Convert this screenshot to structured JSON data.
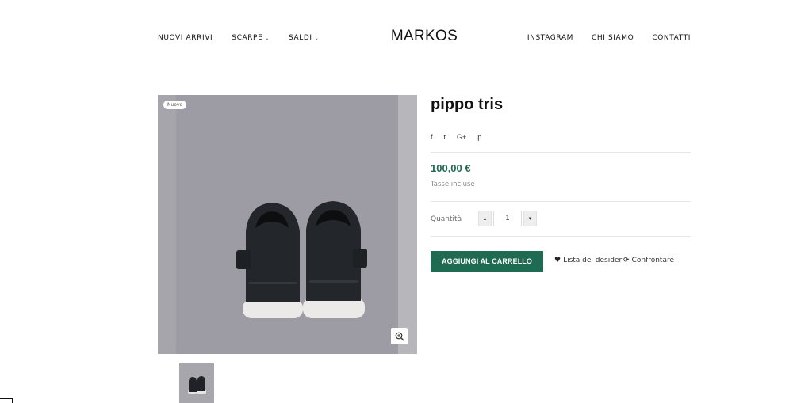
{
  "header": {
    "logo": "MARKOS",
    "nav_left": [
      {
        "label": "NUOVI ARRIVI",
        "has_dropdown": false
      },
      {
        "label": "SCARPE",
        "has_dropdown": true
      },
      {
        "label": "SALDI",
        "has_dropdown": true
      }
    ],
    "nav_right": [
      {
        "label": "INSTAGRAM"
      },
      {
        "label": "CHI SIAMO"
      },
      {
        "label": "CONTATTI"
      }
    ]
  },
  "product": {
    "badge": "Nuovo",
    "title": "pippo tris",
    "social": [
      "f",
      "t",
      "G+",
      "p"
    ],
    "price": "100,00 €",
    "tax_note": "Tasse incluse",
    "quantity_label": "Quantità",
    "quantity": "1",
    "add_to_cart": "AGGIUNGI AL CARRELLO",
    "wishlist": "Lista dei desideri",
    "compare": "Confrontare"
  },
  "colors": {
    "accent": "#1f6b52",
    "image_bg": "#a6a5ab"
  },
  "icons": {
    "zoom": "zoom-in-icon",
    "wishlist": "heart-icon",
    "compare": "refresh-icon"
  }
}
